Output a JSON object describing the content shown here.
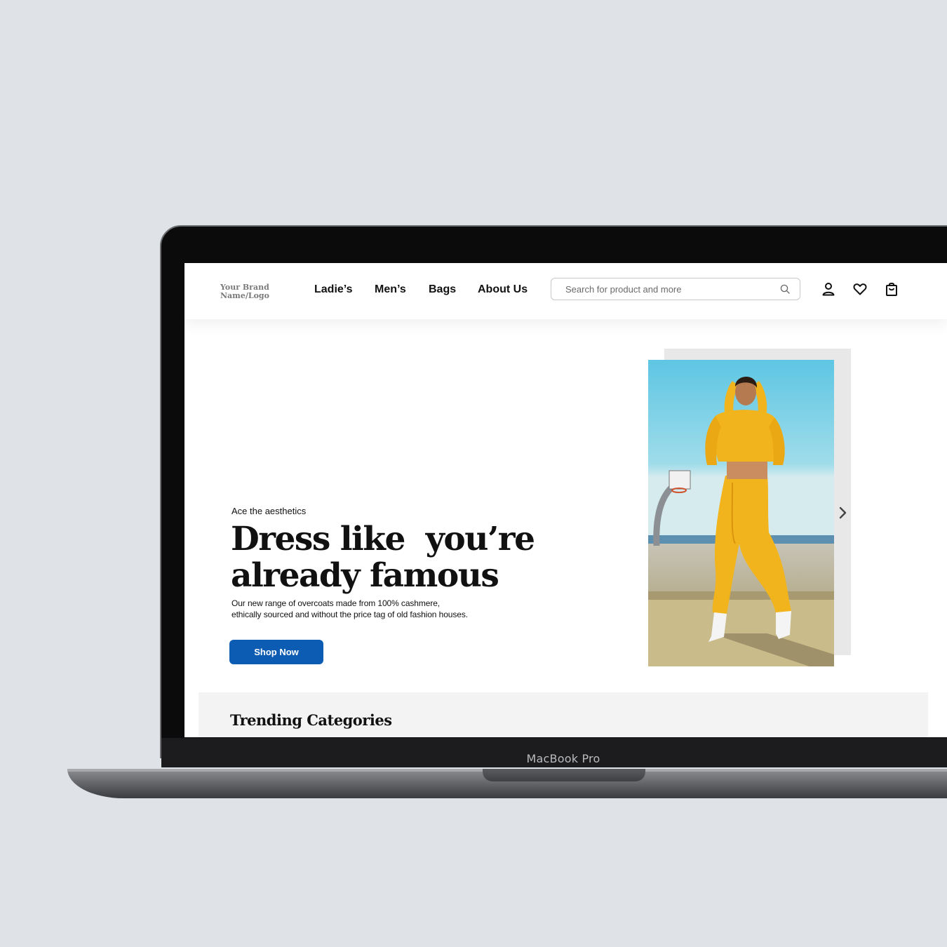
{
  "device": {
    "model_label": "MacBook Pro"
  },
  "brand": {
    "logo_line1": "Your Brand",
    "logo_line2": "Name/Logo"
  },
  "nav": {
    "links": [
      "Ladie’s",
      "Men’s",
      "Bags",
      "About Us"
    ],
    "search_placeholder": "Search for product and more",
    "icons": [
      "search-icon",
      "user-icon",
      "heart-icon",
      "shopping-bag-icon"
    ]
  },
  "hero": {
    "eyebrow": "Ace the aesthetics",
    "title_line1": "Dress like  you’re",
    "title_line2": "already famous",
    "description": "Our new range of overcoats made from 100% cashmere, ethically sourced and without the price tag of old fashion houses.",
    "cta_label": "Shop Now",
    "carousel_icon": "chevron-right-icon"
  },
  "trending": {
    "title": "Trending Categories"
  },
  "colors": {
    "background": "#dfe2e6",
    "accent": "#0d5cb3",
    "outfit_yellow": "#f2b41c",
    "sky": "#7fd2e8"
  }
}
